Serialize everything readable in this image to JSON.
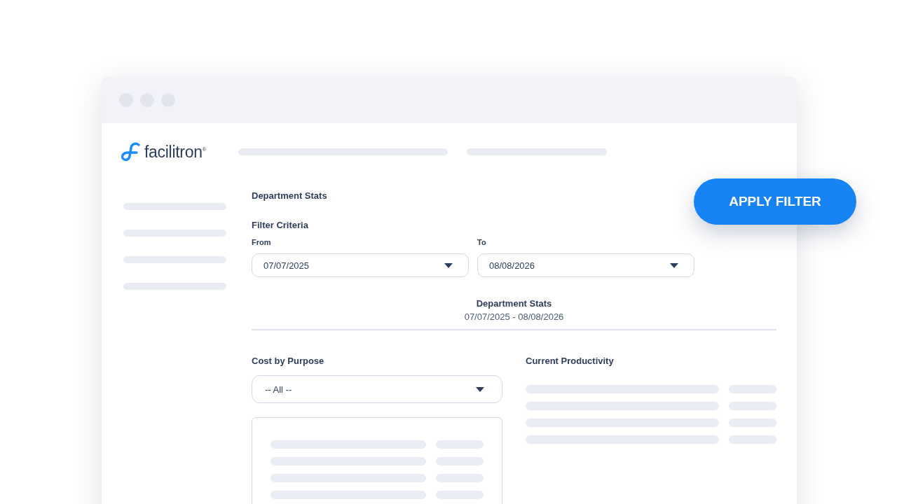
{
  "brand": {
    "name": "facilitron",
    "mark": "®"
  },
  "page_title": "Department Stats",
  "filter": {
    "title": "Filter Criteria",
    "fields": [
      {
        "label": "From",
        "value": "07/07/2025"
      },
      {
        "label": "To",
        "value": "08/08/2026"
      }
    ]
  },
  "apply_button": "APPLY FILTER",
  "summary": {
    "title": "Department Stats",
    "range": "07/07/2025 - 08/08/2026"
  },
  "cost_panel": {
    "title": "Cost by Purpose",
    "select_value": "-- All --"
  },
  "productivity_panel": {
    "title": "Current Productivity"
  }
}
